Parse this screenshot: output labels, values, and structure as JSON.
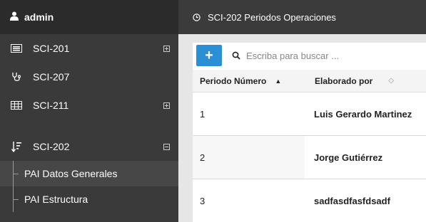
{
  "sidebar": {
    "user": "admin",
    "items": [
      {
        "label": "SCI-201",
        "icon": "list-icon",
        "expandable": true
      },
      {
        "label": "SCI-207",
        "icon": "stethoscope-icon",
        "expandable": false
      },
      {
        "label": "SCI-211",
        "icon": "grid-icon",
        "expandable": true
      },
      {
        "label": "SCI-202",
        "icon": "sort-list-icon",
        "expandable": true,
        "expanded": true
      }
    ],
    "subitems": [
      {
        "label": "PAI Datos Generales",
        "active": true
      },
      {
        "label": "PAI Estructura",
        "active": false
      }
    ]
  },
  "topbar": {
    "title": "SCI-202 Periodos Operaciones"
  },
  "toolbar": {
    "add_label": "+",
    "search_placeholder": "Escriba para buscar ..."
  },
  "table": {
    "columns": [
      "Periodo Número",
      "Elaborado por"
    ],
    "rows": [
      {
        "periodo": "1",
        "elaborado": "Luis Gerardo Martinez"
      },
      {
        "periodo": "2",
        "elaborado": "Jorge Gutiérrez"
      },
      {
        "periodo": "3",
        "elaborado": "sadfasdfasfdsadf"
      }
    ]
  },
  "colors": {
    "accent": "#2b8fd6",
    "sidebar_bg": "#3a3a3a",
    "topbar_bg": "#3b3b3b"
  }
}
